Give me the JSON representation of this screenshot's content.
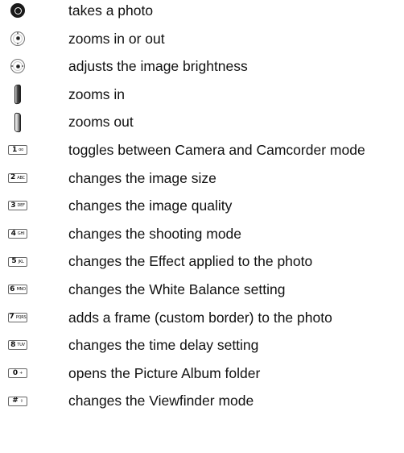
{
  "rows": [
    {
      "icon": "camera-shutter-icon",
      "text": "takes a photo"
    },
    {
      "icon": "nav-updown-icon",
      "text": "zooms in or out"
    },
    {
      "icon": "nav-leftright-icon",
      "text": "adjusts the image brightness"
    },
    {
      "icon": "side-key-up-icon",
      "text": "zooms in"
    },
    {
      "icon": "side-key-down-icon",
      "text": "zooms out"
    },
    {
      "icon": "key-1-icon",
      "key": "1",
      "sub": "oo",
      "text": "toggles between Camera and Camcorder mode"
    },
    {
      "icon": "key-2-icon",
      "key": "2",
      "sub": "ABC",
      "text": "changes the image size"
    },
    {
      "icon": "key-3-icon",
      "key": "3",
      "sub": "DEF",
      "text": "changes the image quality"
    },
    {
      "icon": "key-4-icon",
      "key": "4",
      "sub": "GHI",
      "text": "changes the shooting mode"
    },
    {
      "icon": "key-5-icon",
      "key": "5",
      "sub": "JKL",
      "text": "changes the Effect applied to the photo"
    },
    {
      "icon": "key-6-icon",
      "key": "6",
      "sub": "MNO",
      "text": "changes the White Balance setting"
    },
    {
      "icon": "key-7-icon",
      "key": "7",
      "sub": "PQRS",
      "text": "adds a frame (custom border) to the photo"
    },
    {
      "icon": "key-8-icon",
      "key": "8",
      "sub": "TUV",
      "text": "changes the time delay setting"
    },
    {
      "icon": "key-0-icon",
      "key": "0",
      "sub": "+",
      "text": "opens the Picture Album folder"
    },
    {
      "icon": "key-hash-icon",
      "key": "#",
      "sub": "⇪",
      "text": "changes the Viewfinder mode"
    }
  ]
}
